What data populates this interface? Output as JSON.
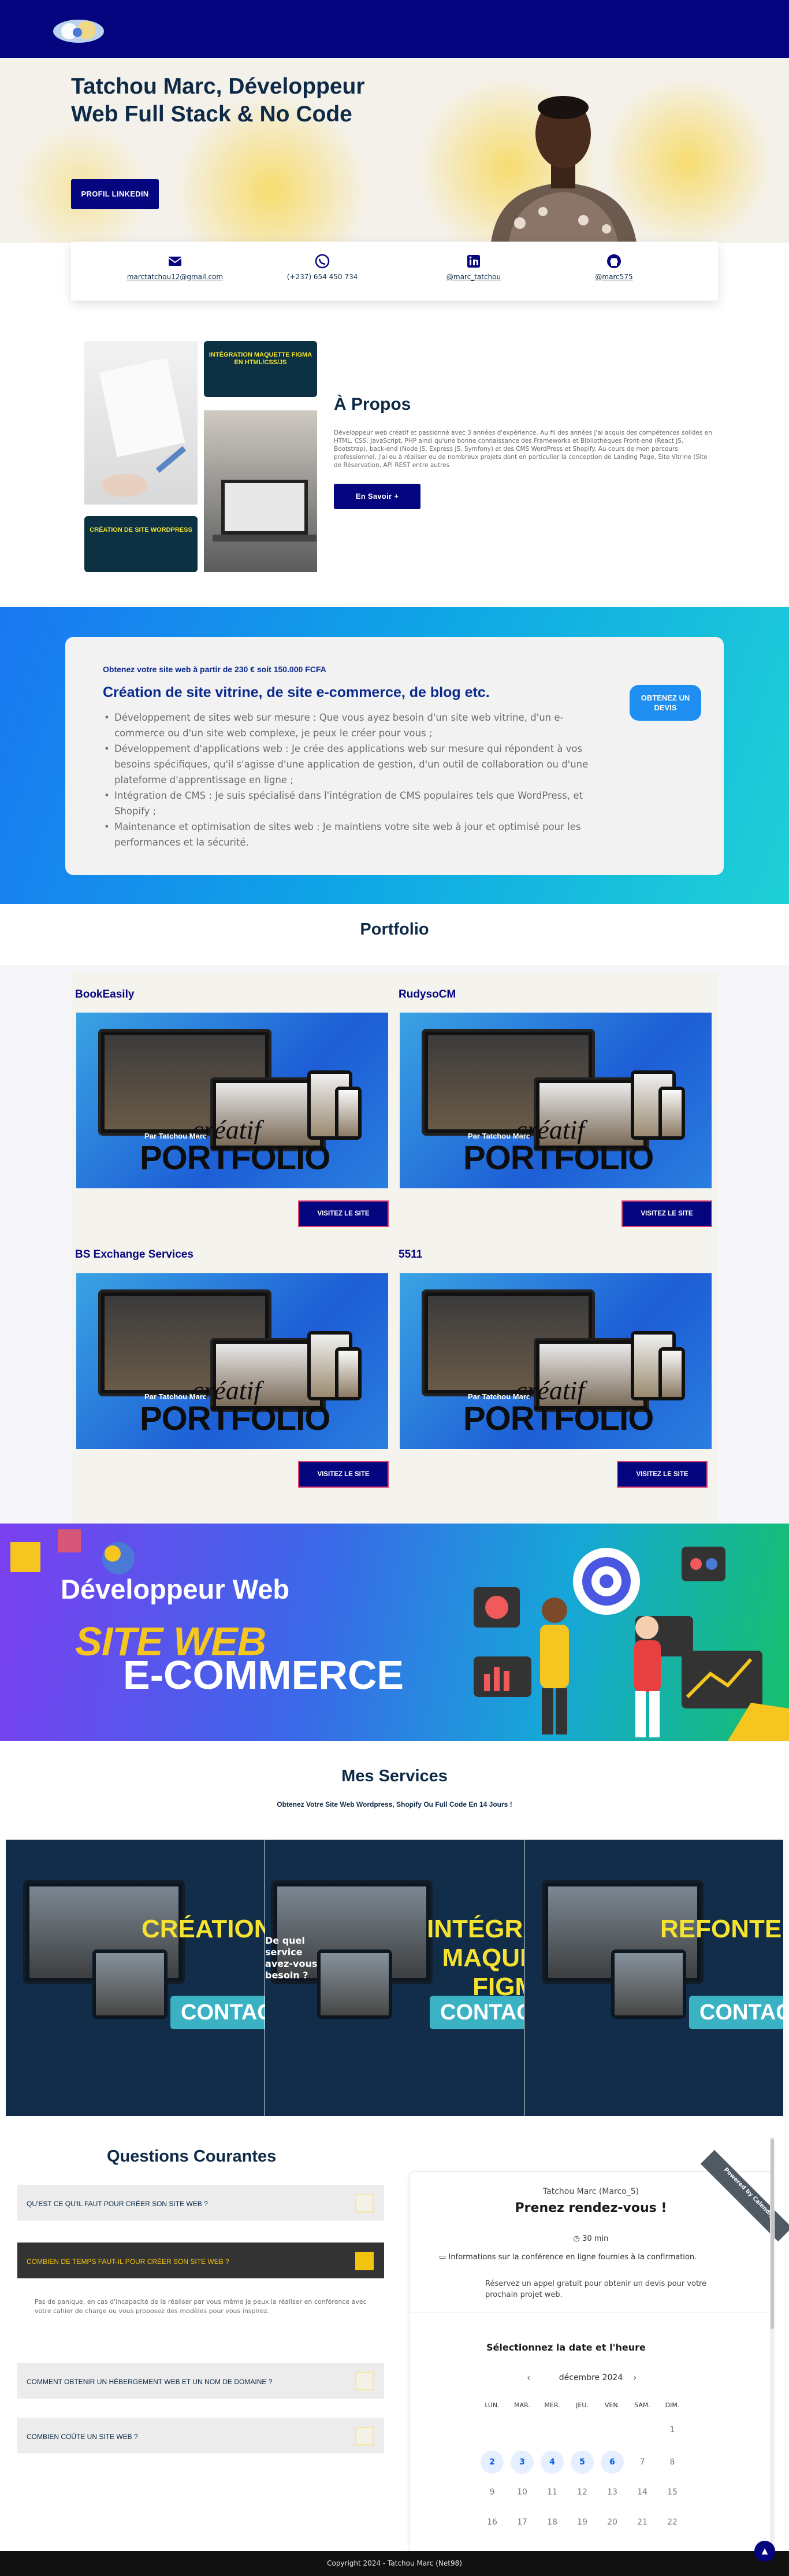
{
  "hero": {
    "title": "Tatchou Marc, Développeur Web Full Stack & No Code",
    "linkedin_button": "PROFIL LINKEDIN"
  },
  "contacts": [
    {
      "icon": "email-icon",
      "text": "marctatchou12@gmail.com"
    },
    {
      "icon": "whatsapp-icon",
      "text": "(+237) 654 450 734"
    },
    {
      "icon": "linkedin-icon",
      "text": "@marc_tatchou"
    },
    {
      "icon": "github-icon",
      "text": "@marc575"
    }
  ],
  "about": {
    "title": "À Propos",
    "text": "Développeur web créatif et passionné avec 3 années d'expérience. Au fil des années j'ai acquis des compétences solides en HTML, CSS, JavaScript, PHP ainsi qu'une bonne connaissance des Frameworks et Bibliothèques Front-end (React JS, Bootstrap), back-end (Node JS, Express JS, Symfony) et des CMS WordPress et Shopify. Au cours de mon parcours professionnel, j'ai eu à réaliser eu de nombreux projets dont en particulier la conception de Landing Page, Site Vitrine (Site de Réservation, API REST entre autres",
    "button": "En Savoir +",
    "badge_1": "INTÉGRATION MAQUETTE FIGMA EN HTML/CSS/JS",
    "badge_2": "CRÉATION DE SITE WORDPRESS"
  },
  "offer": {
    "kicker": "Obtenez votre site web à partir de 230 € soit 150.000 FCFA",
    "title": "Création de site vitrine, de site e-commerce, de blog etc.",
    "items": [
      "Développement de sites web sur mesure : Que vous ayez besoin d'un site web vitrine, d'un e-commerce ou d'un site web complexe, je peux le créer pour vous ;",
      "Développement d'applications web : Je crée des applications web sur mesure qui répondent à vos besoins spécifiques, qu'il s'agisse d'une application de gestion, d'un outil de collaboration ou d'une plateforme d'apprentissage en ligne ;",
      "Intégration de CMS : Je suis spécialisé dans l'intégration de CMS populaires tels que WordPress, et Shopify ;",
      "Maintenance et optimisation de sites web : Je maintiens votre site web à jour et optimisé pour les performances et la sécurité."
    ],
    "button": "OBTENEZ UN DEVIS"
  },
  "portfolio": {
    "title": "Portfolio",
    "projects": [
      {
        "name": "BookEasily"
      },
      {
        "name": "RudysoCM"
      },
      {
        "name": "BS Exchange Services"
      },
      {
        "name": "5511"
      }
    ],
    "visit_label": "VISITEZ LE SITE",
    "image_by": "Par Tatchou Marc",
    "image_word": "PORTFOLIO",
    "image_script": "créatif"
  },
  "banner": {
    "line_1": "Développeur Web",
    "line_2": "SITE WEB",
    "line_3": "E-COMMERCE"
  },
  "services": {
    "title": "Mes Services",
    "subtitle": "Obtenez Votre Site Web Wordpress, Shopify Ou Full Code En 14 Jours !",
    "cards": [
      {
        "big": "CRÉATION DE WORDPRESS",
        "cta": "CONTACTEZ"
      },
      {
        "big": "INTÉGRATION MAQUETTE FIGMA HTML/CSS",
        "cta": "CONTACTEZ"
      },
      {
        "big": "REFONTE DE SITE WORDPRESS",
        "cta": "CONTACTEZ"
      }
    ],
    "card_2_overlay": "De quel service avez-vous besoin ?"
  },
  "faq": {
    "title": "Questions Courantes",
    "questions": [
      "QU'EST CE QU'IL FAUT POUR CRÉER SON SITE WEB ?",
      "COMBIEN DE TEMPS FAUT-IL POUR CRÉER SON SITE WEB ?",
      "COMMENT OBTENIR UN HÉBERGEMENT WEB ET UN NOM DE DOMAINE ?",
      "COMBIEN COÛTE UN SITE WEB ?"
    ],
    "answer": "Pas de panique, en cas d'incapacité de la réaliser par vous même je peux la réaliser en conférence avec votre cahier de charge ou vous proposez des modèles pour vous inspirez."
  },
  "calendly": {
    "ribbon": "Powered by Calendly",
    "owner": "Tatchou Marc (Marco_5)",
    "title": "Prenez rendez-vous !",
    "duration": "30 min",
    "info": "Informations sur la conférence en ligne fournies à la confirmation.",
    "description": "Réservez un appel gratuit pour obtenir un devis pour votre prochain projet web.",
    "date_title": "Sélectionnez la date et l'heure",
    "month": "décembre 2024",
    "days_of_week": [
      "LUN.",
      "MAR.",
      "MER.",
      "JEU.",
      "VEN.",
      "SAM.",
      "DIM."
    ],
    "week_1": [
      "",
      "",
      "",
      "",
      "",
      "",
      "1"
    ],
    "week_2": [
      "2",
      "3",
      "4",
      "5",
      "6",
      "7",
      "8"
    ],
    "week_3": [
      "9",
      "10",
      "11",
      "12",
      "13",
      "14",
      "15"
    ],
    "week_4": [
      "16",
      "17",
      "18",
      "19",
      "20",
      "21",
      "22"
    ],
    "available_days": [
      "2",
      "3",
      "4",
      "5",
      "6"
    ]
  },
  "footer": {
    "text": "Copyright 2024 - Tatchou Marc (Net98)"
  },
  "colors": {
    "navy": "#05057f",
    "title": "#0e2a47",
    "accent_yellow": "#f1c40f"
  }
}
